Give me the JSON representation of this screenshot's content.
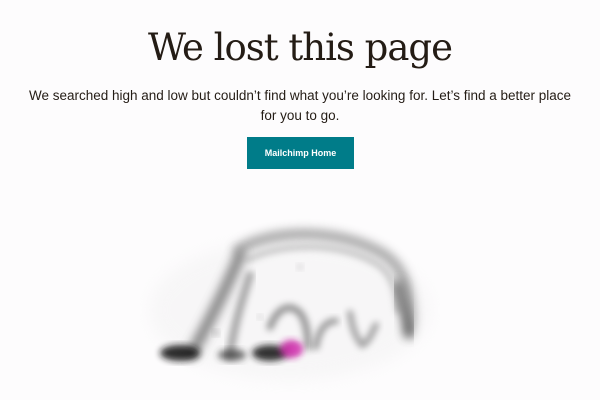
{
  "page": {
    "heading": "We lost this page",
    "message": "We searched high and low but couldn’t find what you’re looking for. Let’s find a better place for you to go.",
    "home_button_label": "Mailchimp Home"
  },
  "colors": {
    "background": "#fdfcfd",
    "text": "#241c15",
    "button": "#007c89",
    "button_text": "#ffffff",
    "illustration_accent": "#c21e9e"
  },
  "illustration": {
    "icon": "blurred-sketch-animal-illustration"
  }
}
